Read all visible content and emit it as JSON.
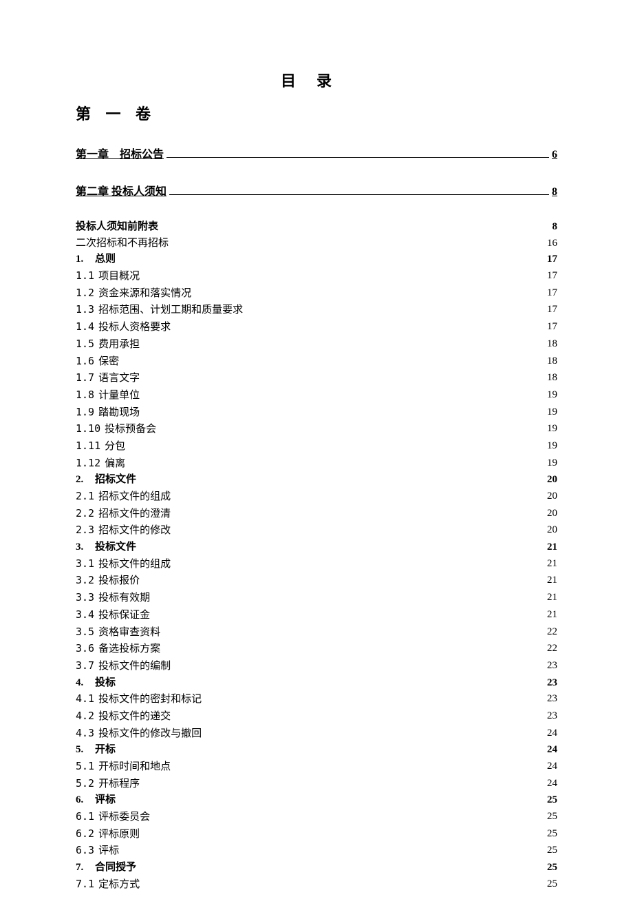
{
  "title": "目录",
  "volume": "第 一 卷",
  "chapters": [
    {
      "label": "第一章　招标公告",
      "page": "6"
    },
    {
      "label": "第二章 投标人须知",
      "page": "8"
    }
  ],
  "entries": [
    {
      "num": "",
      "title": "投标人须知前附表",
      "page": "8",
      "bold": true,
      "type": "plain"
    },
    {
      "num": "",
      "title": "二次招标和不再招标",
      "page": "16",
      "bold": false,
      "type": "plain"
    },
    {
      "num": "1.",
      "title": "总则",
      "page": "17",
      "bold": true,
      "type": "section"
    },
    {
      "num": "1.1",
      "title": "项目概况",
      "page": "17",
      "bold": false,
      "type": "sub"
    },
    {
      "num": "1.2",
      "title": "资金来源和落实情况",
      "page": "17",
      "bold": false,
      "type": "sub"
    },
    {
      "num": "1.3",
      "title": "招标范围、计划工期和质量要求",
      "page": "17",
      "bold": false,
      "type": "sub"
    },
    {
      "num": "1.4",
      "title": "投标人资格要求",
      "page": "17",
      "bold": false,
      "type": "sub"
    },
    {
      "num": "1.5",
      "title": "费用承担",
      "page": "18",
      "bold": false,
      "type": "sub"
    },
    {
      "num": "1.6",
      "title": "保密",
      "page": "18",
      "bold": false,
      "type": "sub"
    },
    {
      "num": "1.7",
      "title": "语言文字",
      "page": "18",
      "bold": false,
      "type": "sub"
    },
    {
      "num": "1.8",
      "title": "计量单位",
      "page": "19",
      "bold": false,
      "type": "sub"
    },
    {
      "num": "1.9",
      "title": "踏勘现场",
      "page": "19",
      "bold": false,
      "type": "sub"
    },
    {
      "num": "1.10",
      "title": "投标预备会",
      "page": "19",
      "bold": false,
      "type": "sub"
    },
    {
      "num": "1.11",
      "title": "分包",
      "page": "19",
      "bold": false,
      "type": "sub"
    },
    {
      "num": "1.12",
      "title": "偏离",
      "page": "19",
      "bold": false,
      "type": "sub"
    },
    {
      "num": "2.",
      "title": "招标文件",
      "page": "20",
      "bold": true,
      "type": "section"
    },
    {
      "num": "2.1",
      "title": "招标文件的组成",
      "page": "20",
      "bold": false,
      "type": "sub"
    },
    {
      "num": "2.2",
      "title": "招标文件的澄清",
      "page": "20",
      "bold": false,
      "type": "sub"
    },
    {
      "num": "2.3",
      "title": "招标文件的修改",
      "page": "20",
      "bold": false,
      "type": "sub"
    },
    {
      "num": "3.",
      "title": "投标文件",
      "page": "21",
      "bold": true,
      "type": "section"
    },
    {
      "num": "3.1",
      "title": "投标文件的组成",
      "page": "21",
      "bold": false,
      "type": "sub"
    },
    {
      "num": "3.2",
      "title": "投标报价",
      "page": "21",
      "bold": false,
      "type": "sub"
    },
    {
      "num": "3.3",
      "title": "投标有效期",
      "page": "21",
      "bold": false,
      "type": "sub"
    },
    {
      "num": "3.4",
      "title": "投标保证金",
      "page": "21",
      "bold": false,
      "type": "sub"
    },
    {
      "num": "3.5",
      "title": "资格审查资料",
      "page": "22",
      "bold": false,
      "type": "sub"
    },
    {
      "num": "3.6",
      "title": "备选投标方案",
      "page": "22",
      "bold": false,
      "type": "sub"
    },
    {
      "num": "3.7",
      "title": "投标文件的编制",
      "page": "23",
      "bold": false,
      "type": "sub"
    },
    {
      "num": "4.",
      "title": "投标",
      "page": "23",
      "bold": true,
      "type": "section"
    },
    {
      "num": "4.1",
      "title": "投标文件的密封和标记",
      "page": "23",
      "bold": false,
      "type": "sub"
    },
    {
      "num": "4.2",
      "title": "投标文件的递交",
      "page": "23",
      "bold": false,
      "type": "sub"
    },
    {
      "num": "4.3",
      "title": "投标文件的修改与撤回",
      "page": "24",
      "bold": false,
      "type": "sub"
    },
    {
      "num": "5.",
      "title": "开标",
      "page": "24",
      "bold": true,
      "type": "section"
    },
    {
      "num": "5.1",
      "title": "开标时间和地点",
      "page": "24",
      "bold": false,
      "type": "sub"
    },
    {
      "num": "5.2",
      "title": "开标程序",
      "page": "24",
      "bold": false,
      "type": "sub"
    },
    {
      "num": "6.",
      "title": "评标",
      "page": "25",
      "bold": true,
      "type": "section"
    },
    {
      "num": "6.1",
      "title": "评标委员会",
      "page": "25",
      "bold": false,
      "type": "sub"
    },
    {
      "num": "6.2",
      "title": "评标原则",
      "page": "25",
      "bold": false,
      "type": "sub"
    },
    {
      "num": "6.3",
      "title": "评标",
      "page": "25",
      "bold": false,
      "type": "sub"
    },
    {
      "num": "7.",
      "title": "合同授予",
      "page": "25",
      "bold": true,
      "type": "section"
    },
    {
      "num": "7.1",
      "title": "定标方式",
      "page": "25",
      "bold": false,
      "type": "sub"
    }
  ]
}
